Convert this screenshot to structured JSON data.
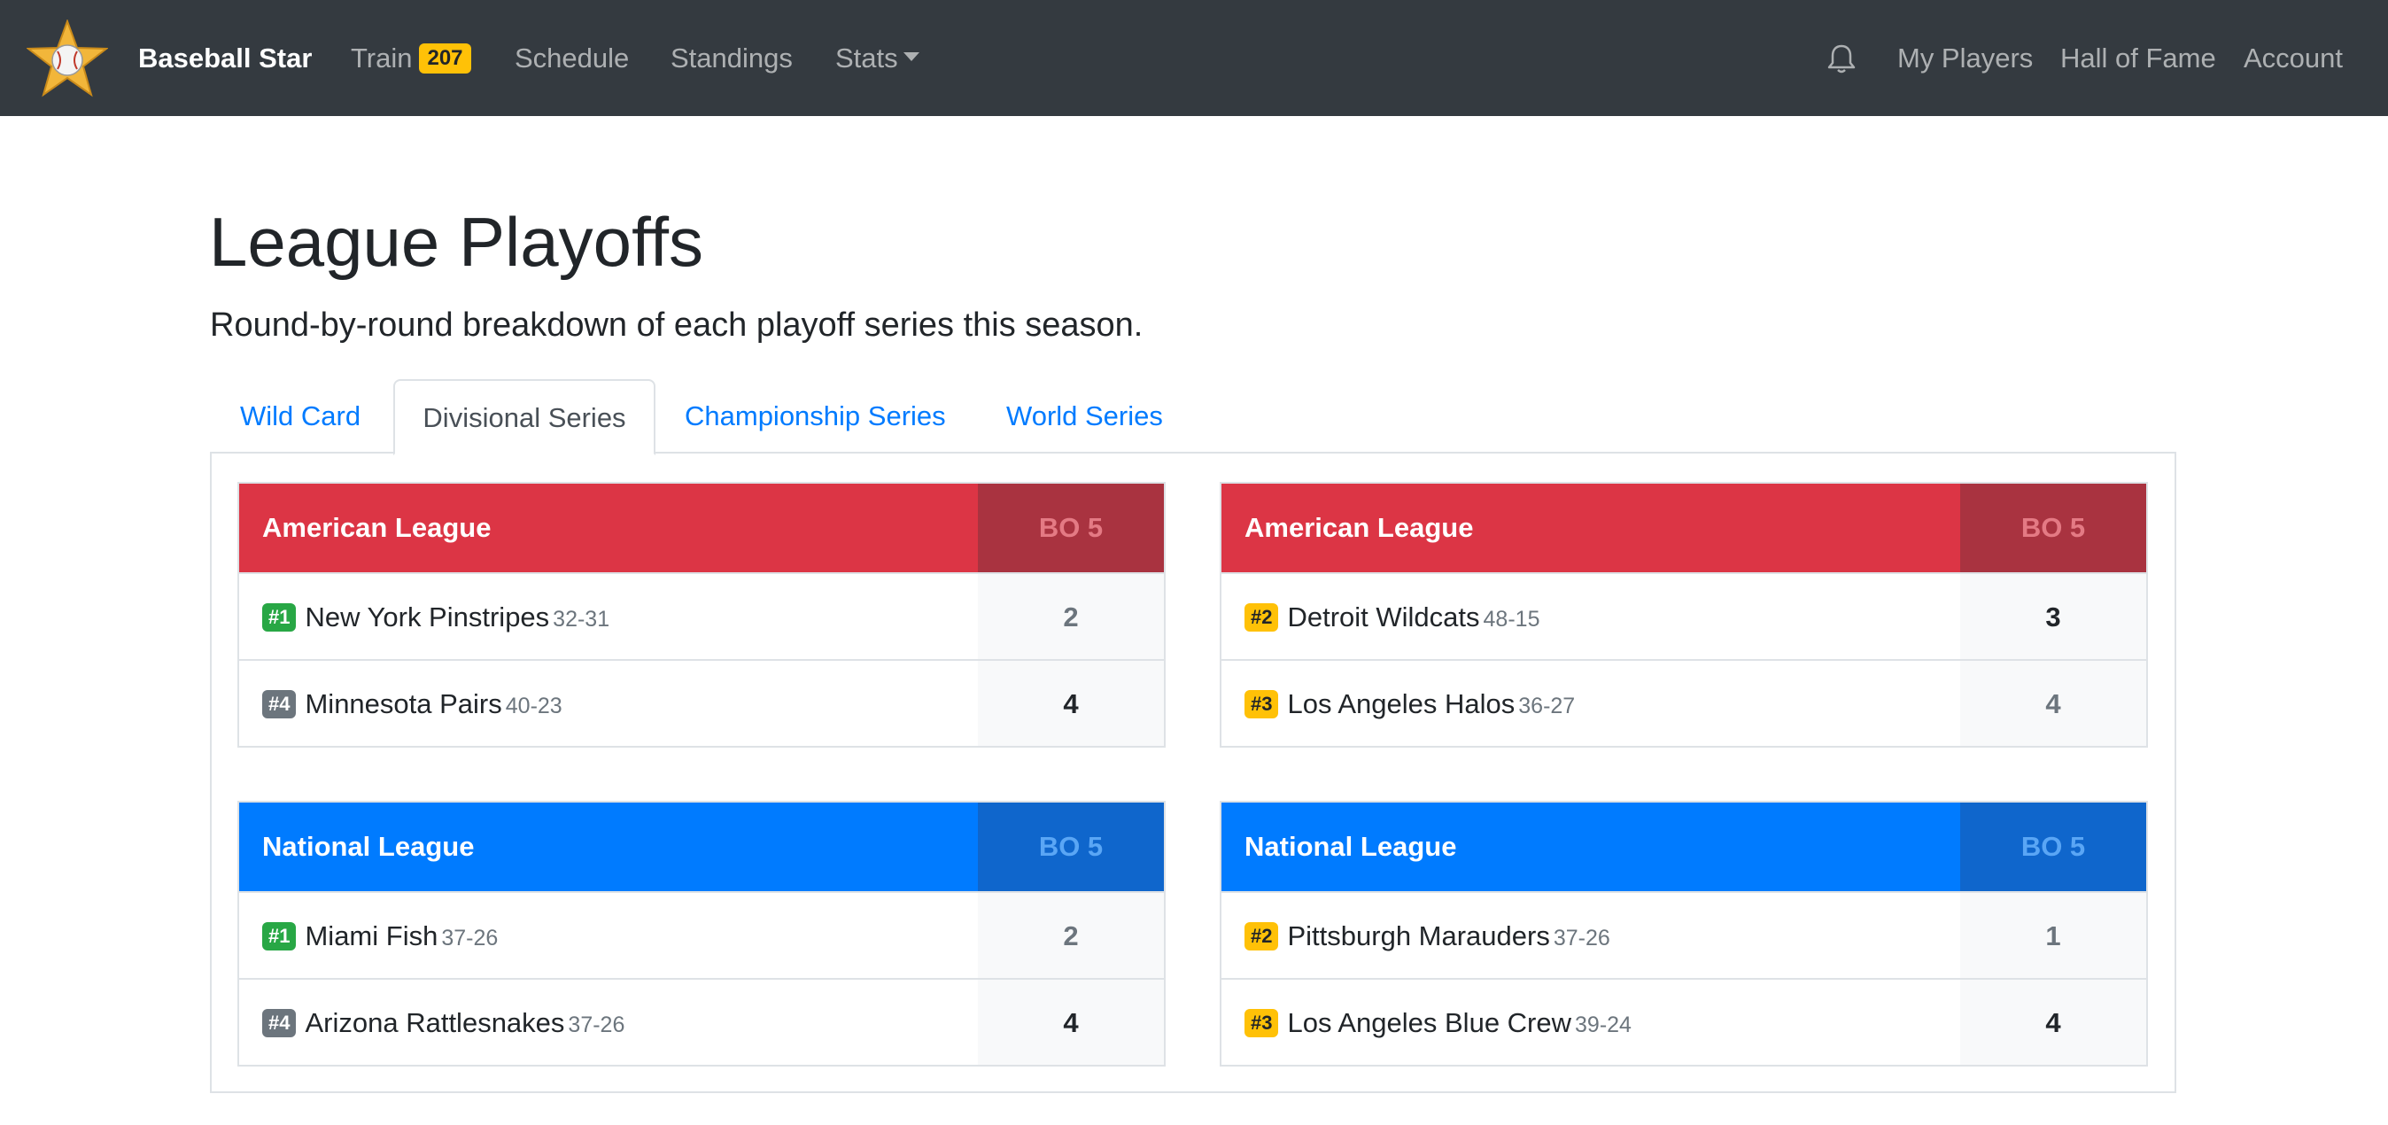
{
  "brand": {
    "name": "Baseball Star",
    "logo_icon": "baseball-star-icon"
  },
  "nav": {
    "left": [
      {
        "label": "Train",
        "badge": "207"
      },
      {
        "label": "Schedule"
      },
      {
        "label": "Standings"
      },
      {
        "label": "Stats"
      }
    ],
    "right": [
      {
        "label": "My Players"
      },
      {
        "label": "Hall of Fame"
      },
      {
        "label": "Account"
      }
    ],
    "bell_icon": "bell-icon"
  },
  "page": {
    "title": "League Playoffs",
    "lead": "Round-by-round breakdown of each playoff series this season."
  },
  "tabs": [
    {
      "label": "Wild Card",
      "active": false
    },
    {
      "label": "Divisional Series",
      "active": true
    },
    {
      "label": "Championship Series",
      "active": false
    },
    {
      "label": "World Series",
      "active": false
    }
  ],
  "series": [
    {
      "league": "American League",
      "format": "BO 5",
      "teams": [
        {
          "seed": "#1",
          "name": "New York Pinstripes",
          "record": "32-31",
          "wins": "2"
        },
        {
          "seed": "#4",
          "name": "Minnesota Pairs",
          "record": "40-23",
          "wins": "4"
        }
      ]
    },
    {
      "league": "American League",
      "format": "BO 5",
      "teams": [
        {
          "seed": "#2",
          "name": "Detroit Wildcats",
          "record": "48-15",
          "wins": "3"
        },
        {
          "seed": "#3",
          "name": "Los Angeles Halos",
          "record": "36-27",
          "wins": "4"
        }
      ]
    },
    {
      "league": "National League",
      "format": "BO 5",
      "teams": [
        {
          "seed": "#1",
          "name": "Miami Fish",
          "record": "37-26",
          "wins": "2"
        },
        {
          "seed": "#4",
          "name": "Arizona Rattlesnakes",
          "record": "37-26",
          "wins": "4"
        }
      ]
    },
    {
      "league": "National League",
      "format": "BO 5",
      "teams": [
        {
          "seed": "#2",
          "name": "Pittsburgh Marauders",
          "record": "37-26",
          "wins": "1"
        },
        {
          "seed": "#3",
          "name": "Los Angeles Blue Crew",
          "record": "39-24",
          "wins": "4"
        }
      ]
    }
  ],
  "colors": {
    "navbar": "#343a40",
    "american_league": "#dc3545",
    "national_league": "#007bff",
    "link": "#007bff",
    "seed_1": "#28a745",
    "seed_2_3": "#ffc107",
    "seed_4": "#6c757d"
  }
}
